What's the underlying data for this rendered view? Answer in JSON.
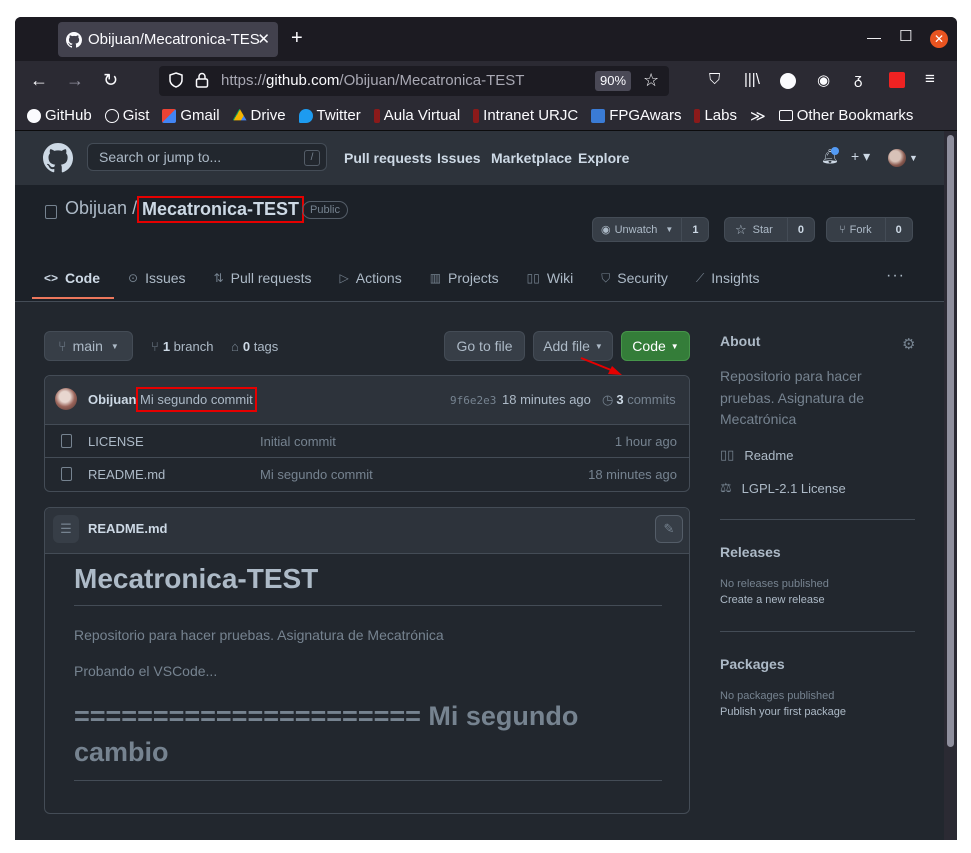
{
  "browser": {
    "tab_title": "Obijuan/Mecatronica-TEST",
    "url_prefix": "https://",
    "url_host": "github.com",
    "url_path": "/Obijuan/Mecatronica-TEST",
    "zoom": "90%",
    "bookmarks": [
      "GitHub",
      "Gist",
      "Gmail",
      "Drive",
      "Twitter",
      "Aula Virtual",
      "Intranet URJC",
      "FPGAwars",
      "Labs",
      "Other Bookmarks"
    ]
  },
  "gh_header": {
    "search_placeholder": "Search or jump to...",
    "search_key": "/",
    "nav": [
      "Pull requests",
      "Issues",
      "Marketplace",
      "Explore"
    ]
  },
  "repo": {
    "owner": "Obijuan",
    "separator": "/",
    "name": "Mecatronica-TEST",
    "visibility": "Public",
    "watch_label": "Unwatch",
    "watch_count": "1",
    "star_label": "Star",
    "star_count": "0",
    "fork_label": "Fork",
    "fork_count": "0",
    "tabs": [
      "Code",
      "Issues",
      "Pull requests",
      "Actions",
      "Projects",
      "Wiki",
      "Security",
      "Insights"
    ]
  },
  "branchbar": {
    "branch": "main",
    "branches_count": "1",
    "branches_label": "branch",
    "tags_count": "0",
    "tags_label": "tags",
    "goto_file": "Go to file",
    "add_file": "Add file",
    "code": "Code"
  },
  "commit": {
    "author": "Obijuan",
    "message": "Mi segundo commit",
    "sha": "9f6e2e3",
    "time": "18 minutes ago",
    "count": "3",
    "count_label": "commits"
  },
  "files": [
    {
      "name": "LICENSE",
      "message": "Initial commit",
      "age": "1 hour ago"
    },
    {
      "name": "README.md",
      "message": "Mi segundo commit",
      "age": "18 minutes ago"
    }
  ],
  "readme": {
    "filename": "README.md",
    "h1": "Mecatronica-TEST",
    "p1": "Repositorio para hacer pruebas. Asignatura de Mecatrónica",
    "p2": "Probando el VSCode...",
    "h2": "====================== Mi segundo cambio"
  },
  "sidebar": {
    "about_title": "About",
    "description": "Repositorio para hacer pruebas. Asignatura de Mecatrónica",
    "readme_link": "Readme",
    "license_link": "LGPL-2.1 License",
    "releases_title": "Releases",
    "releases_none": "No releases published",
    "releases_create": "Create a new release",
    "packages_title": "Packages",
    "packages_none": "No packages published",
    "packages_publish": "Publish your first package"
  },
  "colors": {
    "annotation_red": "#e60000",
    "code_button_green": "#347d39",
    "active_tab_underline": "#ec775c"
  }
}
